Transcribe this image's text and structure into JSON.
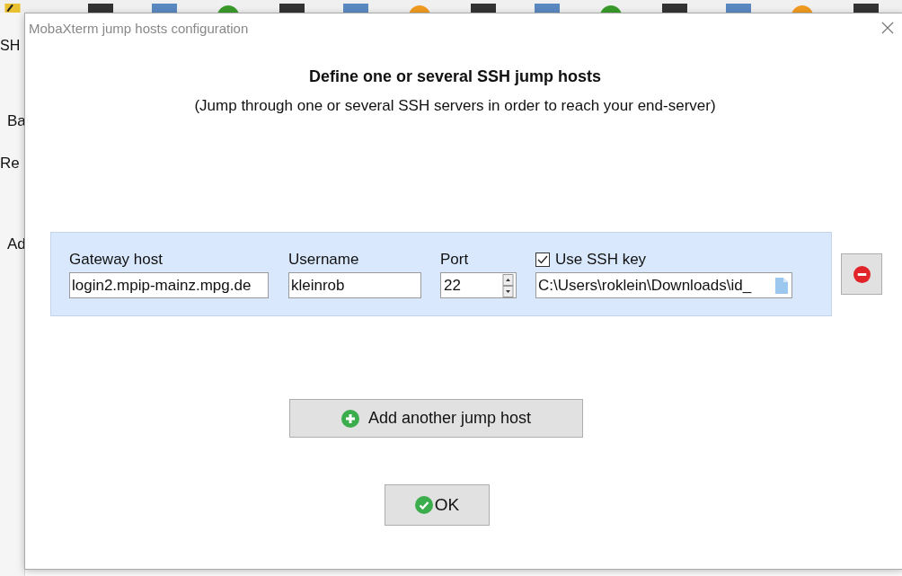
{
  "background_app": {
    "side_labels": [
      "SH",
      "Ba",
      "Re",
      "Ad"
    ]
  },
  "window": {
    "title": "MobaXterm jump hosts configuration"
  },
  "heading": "Define one or several SSH jump hosts",
  "subheading": "(Jump through one or several SSH servers in order to reach your end-server)",
  "columns": {
    "gateway_host": "Gateway host",
    "username": "Username",
    "port": "Port"
  },
  "jump_hosts": [
    {
      "gateway_host": "login2.mpip-mainz.mpg.de",
      "username": "kleinrob",
      "port": "22",
      "use_ssh_key": {
        "label": "Use SSH key",
        "checked": true
      },
      "key_path": "C:\\Users\\roklein\\Downloads\\id_"
    }
  ],
  "add_button": "Add another jump host",
  "ok_button": "OK"
}
